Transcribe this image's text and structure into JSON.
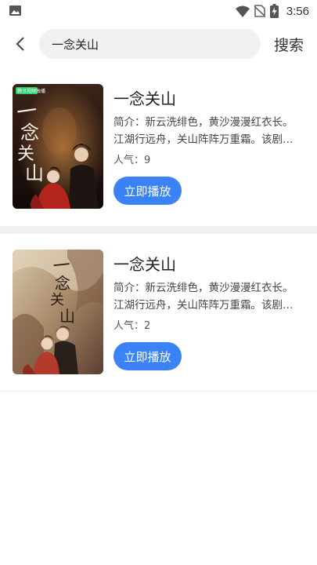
{
  "status_bar": {
    "time": "3:56",
    "icons": [
      "image-icon",
      "wifi-icon",
      "no-sim-icon",
      "battery-charging-icon"
    ]
  },
  "search": {
    "query": "一念关山",
    "submit_label": "搜索"
  },
  "results": [
    {
      "title": "一念关山",
      "description": "简介：新云洗绯色，黄沙漫漫红衣长。江湖行远舟，关山阵阵万重霜。该剧讲述…",
      "popularity": "人气：9",
      "play_label": "立即播放",
      "poster": {
        "badge": "腾讯视频独播",
        "colors": [
          "#2a1a14",
          "#7a3a22",
          "#c0392b"
        ]
      }
    },
    {
      "title": "一念关山",
      "description": "简介：新云洗绯色，黄沙漫漫红衣长。江湖行远舟，关山阵阵万重霜。该剧讲述…",
      "popularity": "人气：2",
      "play_label": "立即播放",
      "poster": {
        "colors": [
          "#c9b79a",
          "#6b4a3a",
          "#b23a2e"
        ]
      }
    }
  ],
  "colors": {
    "accent": "#3b82f6",
    "divider": "#f0f0f0"
  }
}
